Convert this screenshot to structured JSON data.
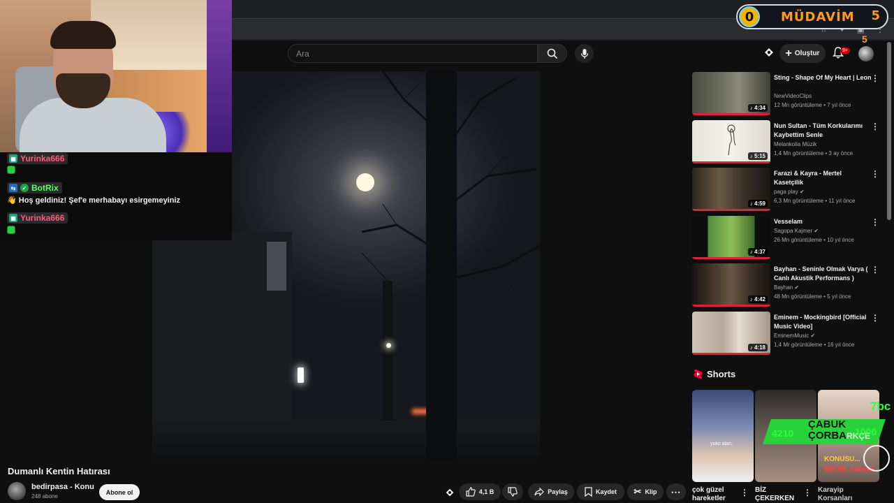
{
  "overlay": {
    "badge_level": "0",
    "badge_label": "MÜDAVİM",
    "badge_count": "5",
    "badge_sub": "5",
    "stream_green_text_line1": "ÇABUK",
    "stream_green_text_line2": "ÇORBA",
    "stream_green_text_suffix": "RKÇE",
    "stream_num_left": "4210",
    "stream_num_right": "1000",
    "stream_corner": "7bc",
    "stream_konu": "KONUSU...",
    "stream_mistik": "MİSTİK SANNE"
  },
  "chat": {
    "messages": [
      {
        "user": "Yurinka666",
        "user_color": "#ff5a7a",
        "text": ""
      },
      {
        "user": "BotRix",
        "user_color": "#5dff6a",
        "text": "Hoş geldiniz! Şef'e merhabayı esirgemeyiniz",
        "icon": "👋"
      },
      {
        "user": "Yurinka666",
        "user_color": "#ff5a7a",
        "text": ""
      }
    ]
  },
  "header": {
    "search_placeholder": "Ara",
    "create_label": "Oluştur",
    "notification_count": "9+"
  },
  "video": {
    "title": "Dumanlı Kentin Hatırası",
    "channel": "bedirpasa - Konu",
    "subscribers": "248 abone",
    "subscribe_label": "Abone ol",
    "likes": "4,1 B",
    "share_label": "Paylaş",
    "save_label": "Kaydet",
    "clip_label": "Klip"
  },
  "recommendations": [
    {
      "title": "Sting - Shape Of My Heart | Leon",
      "channel": "NewVideoClips",
      "meta": "12 Mn görüntüleme • 7 yıl önce",
      "duration": "4:34",
      "verified": false
    },
    {
      "title": "Nun Sultan  - Tüm Korkularımı Kaybettim Senle",
      "channel": "Melankolia Müzik",
      "meta": "1,4 Mn görüntüleme • 3 ay önce",
      "duration": "5:15",
      "verified": false
    },
    {
      "title": "Farazi & Kayra - Mertel Kasetçilik",
      "channel": "paga play",
      "meta": "6,3 Mn görüntüleme • 11 yıl önce",
      "duration": "4:59",
      "verified": true
    },
    {
      "title": "Vesselam",
      "channel": "Sagopa Kajmer",
      "meta": "26 Mn görüntüleme • 10 yıl önce",
      "duration": "4:37",
      "verified": true
    },
    {
      "title": "Bayhan - Seninle Olmak Varya ( Canlı Akustik Performans )",
      "channel": "Bayhan",
      "meta": "48 Mn görüntüleme • 5 yıl önce",
      "duration": "4:42",
      "verified": true
    },
    {
      "title": "Eminem - Mockingbird [Official Music Video]",
      "channel": "EminemMusic",
      "meta": "1,4 Mr görüntüleme • 16 yıl önce",
      "duration": "4:18",
      "verified": true
    }
  ],
  "shorts": {
    "heading": "Shorts",
    "items": [
      {
        "title": "çok güzel hareketler",
        "overlay_text": "yuko alan,"
      },
      {
        "title": "BİZ ÇEKERKEN",
        "overlay_text": ""
      },
      {
        "title": "Karayip Korsanları",
        "overlay_text": ""
      }
    ]
  }
}
